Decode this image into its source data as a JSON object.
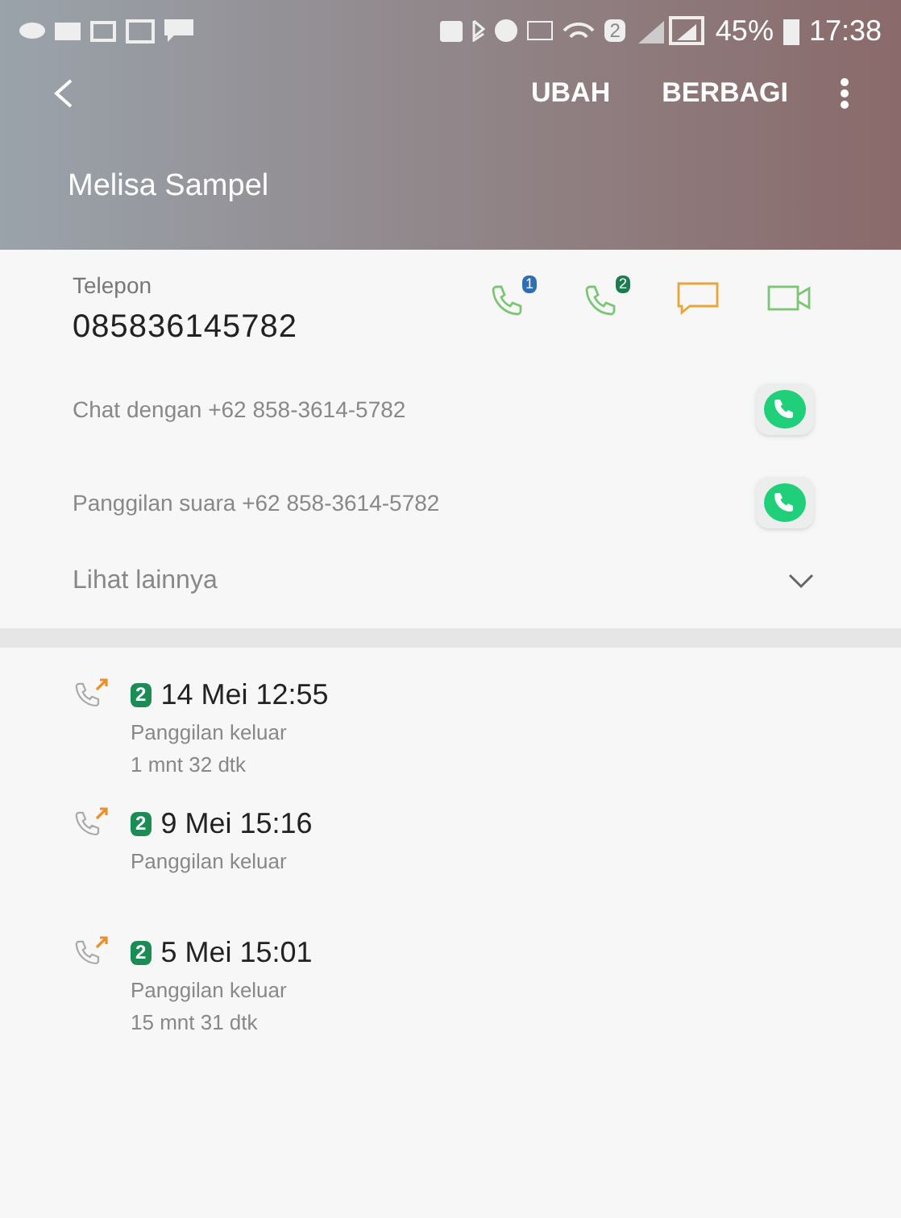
{
  "status_bar": {
    "sim": "2",
    "battery": "45%",
    "time": "17:38"
  },
  "toolbar": {
    "actions": [
      "UBAH",
      "BERBAGI"
    ]
  },
  "contact": {
    "name": "Melisa Sampel"
  },
  "phone": {
    "label": "Telepon",
    "number": "085836145782",
    "actions": [
      {
        "kind": "call",
        "sim": "1",
        "color": "#2f6db5"
      },
      {
        "kind": "call",
        "sim": "2",
        "color": "#1e7a4f"
      },
      {
        "kind": "message"
      },
      {
        "kind": "video"
      }
    ]
  },
  "links": [
    {
      "text": "Chat dengan +62 858-3614-5782"
    },
    {
      "text": "Panggilan suara +62 858-3614-5782"
    }
  ],
  "more": {
    "label": "Lihat lainnya",
    "expanded": false
  },
  "calls": [
    {
      "sim": "2",
      "date": "14 Mei 12:55",
      "type": "Panggilan keluar",
      "duration": "1 mnt 32 dtk"
    },
    {
      "sim": "2",
      "date": "9 Mei 15:16",
      "type": "Panggilan keluar"
    },
    {
      "sim": "2",
      "date": "5 Mei 15:01",
      "type": "Panggilan keluar",
      "duration": "15 mnt 31 dtk"
    }
  ]
}
